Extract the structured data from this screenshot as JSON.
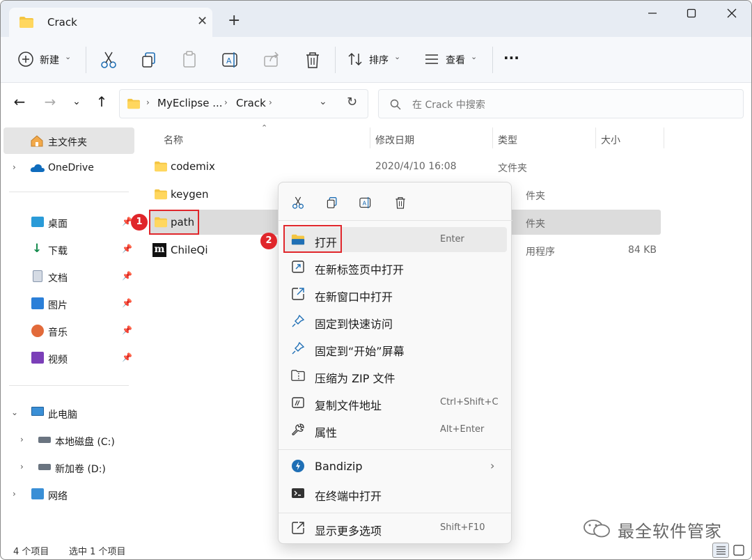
{
  "window": {
    "tab_title": "Crack",
    "new_tab_symbol": "+",
    "tab_close_symbol": "✕"
  },
  "toolbar": {
    "new_label": "新建",
    "sort_label": "排序",
    "view_label": "查看",
    "more_label": "···"
  },
  "address": {
    "crumbs": [
      "MyEclipse ...",
      "Crack"
    ],
    "search_placeholder": "在 Crack 中搜索"
  },
  "sidebar": {
    "home": "主文件夹",
    "onedrive": "OneDrive",
    "quick": [
      "桌面",
      "下载",
      "文档",
      "图片",
      "音乐",
      "视频"
    ],
    "this_pc": "此电脑",
    "drives": [
      "本地磁盘 (C:)",
      "新加卷 (D:)"
    ],
    "network": "网络"
  },
  "columns": {
    "name": "名称",
    "date": "修改日期",
    "type": "类型",
    "size": "大小"
  },
  "files": [
    {
      "name": "codemix",
      "date": "2020/4/10 16:08",
      "type": "文件夹",
      "size": ""
    },
    {
      "name": "keygen",
      "date": "",
      "type": "件夹",
      "size": ""
    },
    {
      "name": "path",
      "date": "",
      "type": "件夹",
      "size": ""
    },
    {
      "name": "ChileQi",
      "date": "",
      "type": "用程序",
      "size": "84 KB"
    }
  ],
  "context_menu": {
    "items": [
      {
        "label": "打开",
        "shortcut": "Enter"
      },
      {
        "label": "在新标签页中打开",
        "shortcut": ""
      },
      {
        "label": "在新窗口中打开",
        "shortcut": ""
      },
      {
        "label": "固定到快速访问",
        "shortcut": ""
      },
      {
        "label": "固定到“开始”屏幕",
        "shortcut": ""
      },
      {
        "label": "压缩为 ZIP 文件",
        "shortcut": ""
      },
      {
        "label": "复制文件地址",
        "shortcut": "Ctrl+Shift+C"
      },
      {
        "label": "属性",
        "shortcut": "Alt+Enter"
      },
      {
        "label": "Bandizip",
        "shortcut": ""
      },
      {
        "label": "在终端中打开",
        "shortcut": ""
      },
      {
        "label": "显示更多选项",
        "shortcut": "Shift+F10"
      }
    ]
  },
  "annotations": {
    "step1": "1",
    "step2": "2"
  },
  "status": {
    "count": "4 个项目",
    "selected": "选中 1 个项目"
  },
  "watermark": "最全软件管家",
  "colors": {
    "accent": "#0067c0",
    "folder": "#f4c542",
    "badge_red": "#e0262b",
    "selection": "#e0e0e0"
  }
}
